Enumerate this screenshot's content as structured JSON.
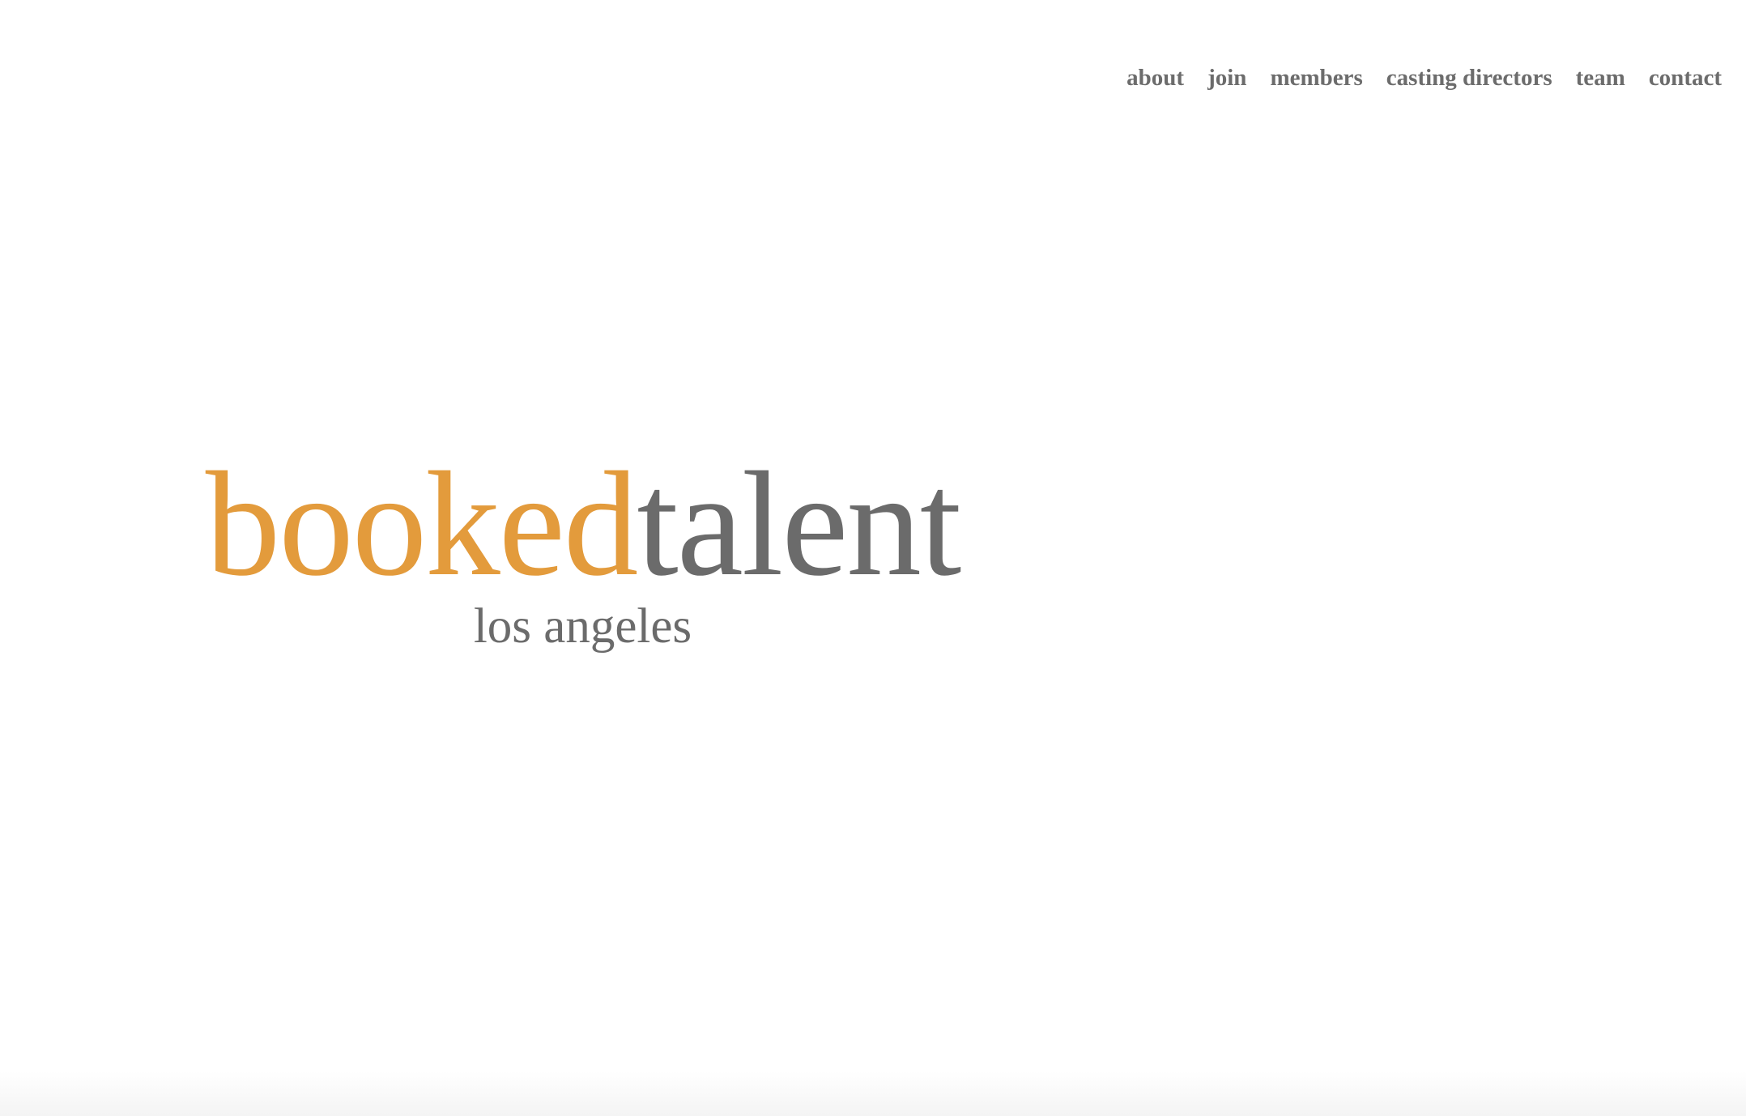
{
  "nav": {
    "items": [
      {
        "label": "about"
      },
      {
        "label": "join"
      },
      {
        "label": "members"
      },
      {
        "label": "casting directors"
      },
      {
        "label": "team"
      },
      {
        "label": "contact"
      }
    ]
  },
  "logo": {
    "part1": "booked",
    "part2": "talent",
    "subtitle": "los angeles"
  },
  "colors": {
    "accent": "#e39b3c",
    "text": "#6b6b6b",
    "background": "#ffffff"
  }
}
